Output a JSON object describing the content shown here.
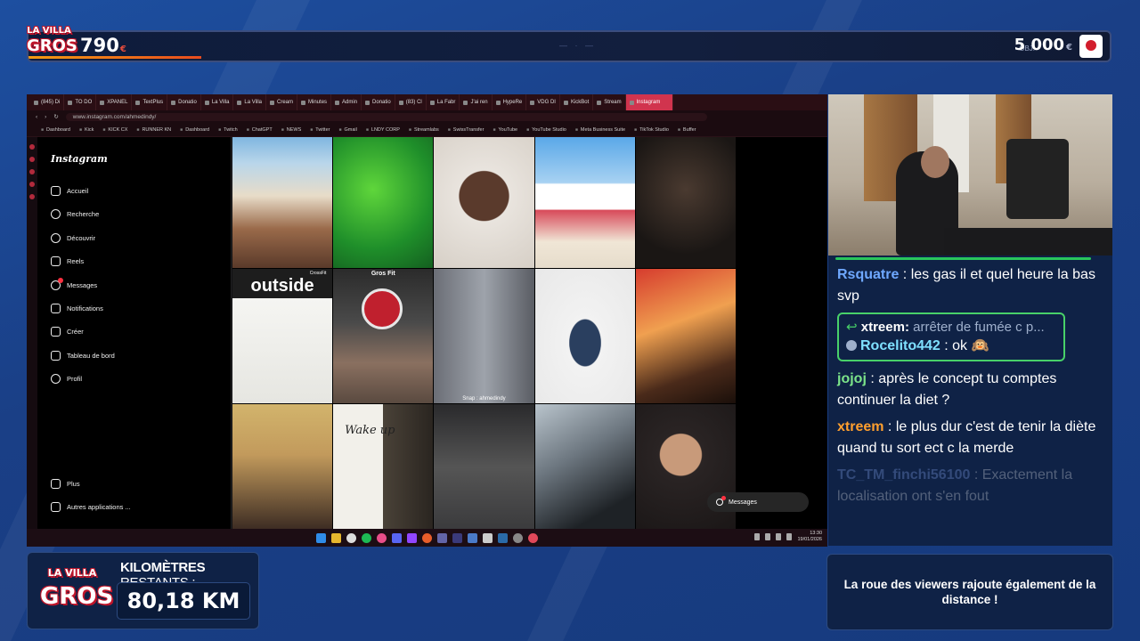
{
  "topbar": {
    "score": "790",
    "score_unit": "€",
    "goal_label": "OBJ.",
    "goal": "5 000",
    "goal_unit": "€",
    "progress_fraction": 0.16
  },
  "logo": {
    "line1": "LA VILLA",
    "line2": "DES",
    "line3": "GROS"
  },
  "browser": {
    "tabs": [
      "(845) Di",
      "TO DO",
      "XPANEL",
      "TextPlus",
      "Donatio",
      "La Villa",
      "La Villa",
      "Cream",
      "Minutes",
      "Admin",
      "Donatio",
      "(83) Cl",
      "La Fabr",
      "J'ai ren",
      "HypeRe",
      "VDG DI",
      "KickBot",
      "Stream",
      "Instagram"
    ],
    "url": "www.instagram.com/ahmedindy/",
    "bookmarks": [
      "Dashboard",
      "Kick",
      "KICK CX",
      "RUNNER KN",
      "Dashboard",
      "Twitch",
      "ChatGPT",
      "NEWS",
      "Twitter",
      "Gmail",
      "LNDY CORP",
      "Streamlabs",
      "SwissTransfer",
      "YouTube",
      "YouTube Studio",
      "Meta Business Suite",
      "TikTok Studio",
      "Buffer"
    ]
  },
  "instagram": {
    "logo": "Instagram",
    "nav": [
      {
        "label": "Accueil",
        "icon": "home-icon"
      },
      {
        "label": "Recherche",
        "icon": "search-icon"
      },
      {
        "label": "Découvrir",
        "icon": "compass-icon"
      },
      {
        "label": "Reels",
        "icon": "reels-icon"
      },
      {
        "label": "Messages",
        "icon": "messenger-icon"
      },
      {
        "label": "Notifications",
        "icon": "heart-icon"
      },
      {
        "label": "Créer",
        "icon": "plus-icon"
      },
      {
        "label": "Tableau de bord",
        "icon": "dashboard-icon"
      },
      {
        "label": "Profil",
        "icon": "profile-icon"
      }
    ],
    "bottom_nav": [
      {
        "label": "Plus",
        "icon": "menu-icon"
      },
      {
        "label": "Autres applications ...",
        "icon": "apps-icon"
      }
    ],
    "overlays": {
      "outside": "outside",
      "crossfit": "CrossFit",
      "gros_fit": "Gros Fit",
      "snap": "Snap : ahmedindy",
      "wake_up": "Wake up"
    },
    "messages_pill": "Messages"
  },
  "taskbar": {
    "time": "13:30",
    "date": "19/01/2026"
  },
  "chat": [
    {
      "user": "Rsquatre",
      "color": "#6fa8ff",
      "text": "les gas il et quel heure la bas svp"
    },
    {
      "reply": true,
      "reply_user": "xtreem:",
      "reply_text": "arrêter de fumée c p...",
      "user": "Rocelito442",
      "color": "#7fe0ff",
      "text": "ok 🙉"
    },
    {
      "user": "jojoj",
      "color": "#7be389",
      "text": "après le concept tu comptes continuer la diet ?"
    },
    {
      "user": "xtreem",
      "color": "#ff9f2e",
      "text": "le plus dur c'est de tenir la diète quand tu sort ect c la merde"
    },
    {
      "user": "TC_TM_finchi56100",
      "color": "#8fb2ff",
      "text": "Exactement la localisation ont s'en fout",
      "faded": true
    }
  ],
  "km": {
    "label_bold": "KILOMÈTRES",
    "label_rest": "RESTANTS :",
    "value": "80,18 KM"
  },
  "info": {
    "text": "La roue des viewers rajoute également de la distance !"
  }
}
